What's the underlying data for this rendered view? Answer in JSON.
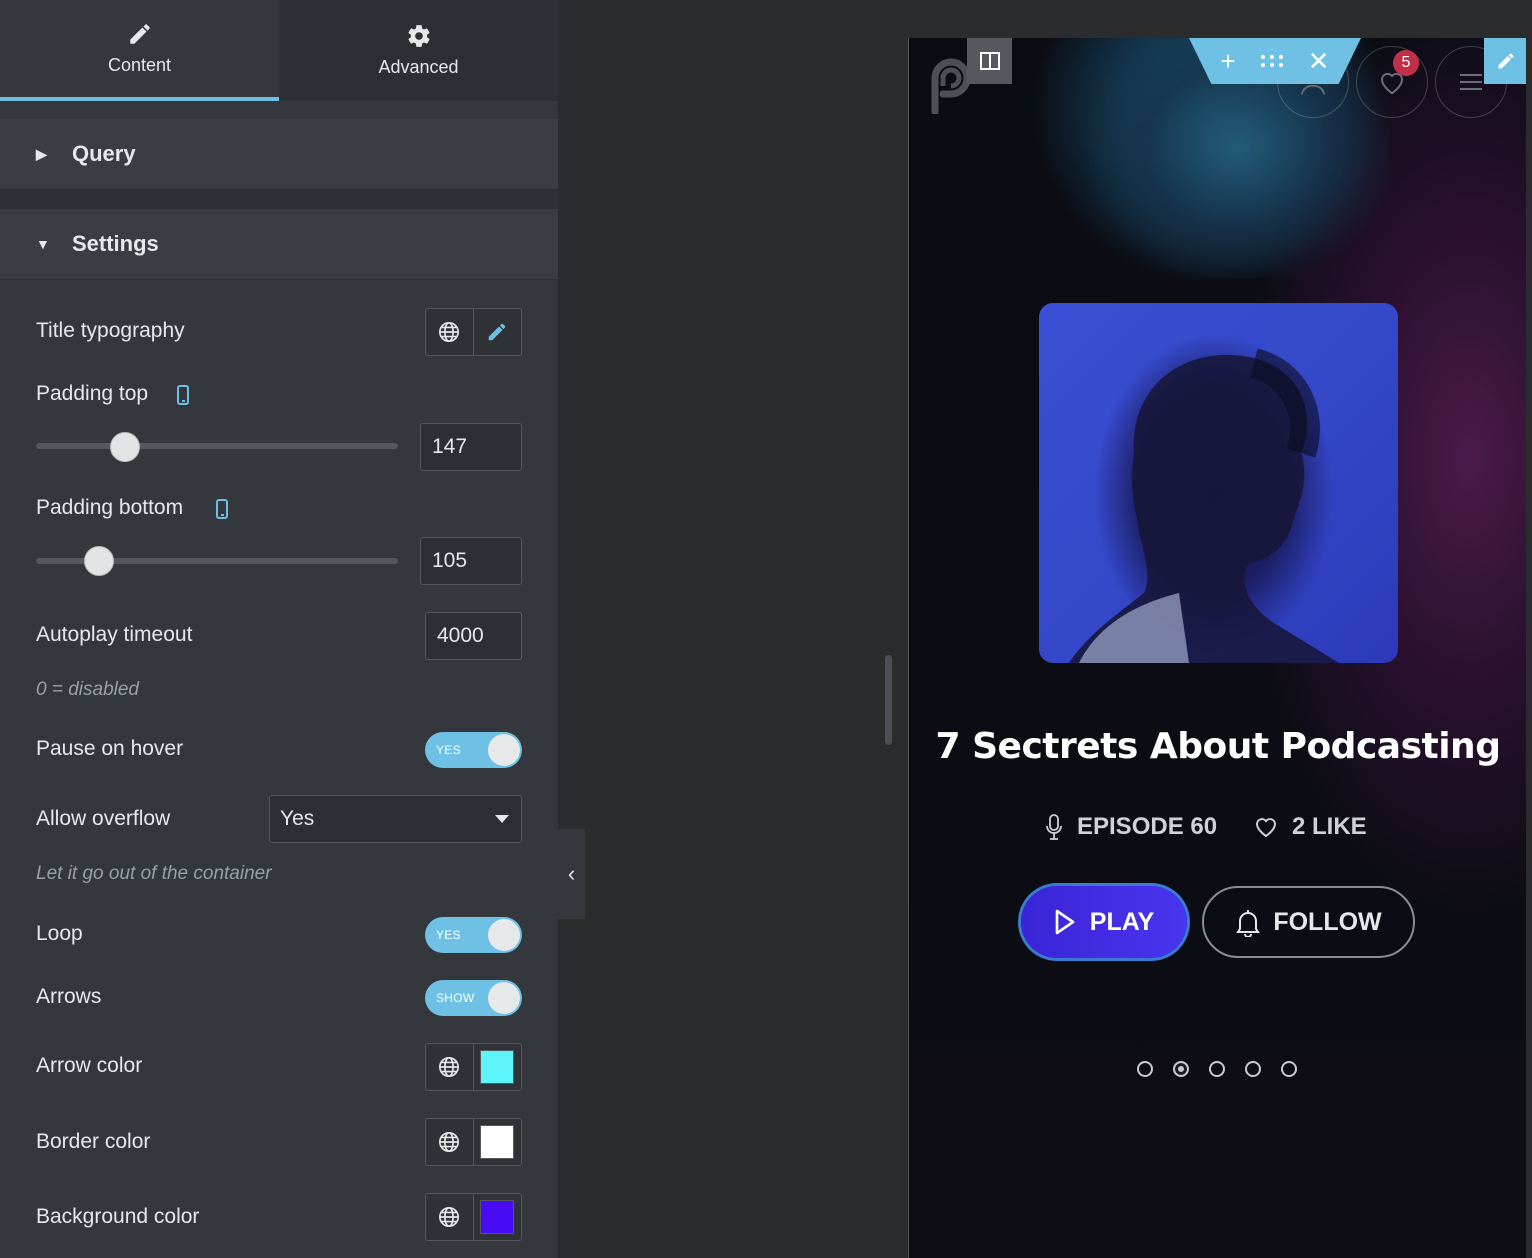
{
  "tabs": [
    {
      "label": "Content",
      "icon": "pencil-icon",
      "active": true
    },
    {
      "label": "Advanced",
      "icon": "gear-icon",
      "active": false
    }
  ],
  "sections": {
    "query": {
      "title": "Query",
      "expanded": false
    },
    "settings": {
      "title": "Settings",
      "expanded": true
    }
  },
  "settings": {
    "title_typography": {
      "label": "Title typography"
    },
    "padding_top": {
      "label": "Padding top",
      "value": "147",
      "slider_fraction": 0.25
    },
    "padding_bottom": {
      "label": "Padding bottom",
      "value": "105",
      "slider_fraction": 0.18
    },
    "autoplay_timeout": {
      "label": "Autoplay timeout",
      "value": "4000",
      "hint": "0 = disabled"
    },
    "pause_on_hover": {
      "label": "Pause on hover",
      "toggle": "YES",
      "on": true
    },
    "allow_overflow": {
      "label": "Allow overflow",
      "selected": "Yes",
      "hint": "Let it go out of the container"
    },
    "loop": {
      "label": "Loop",
      "toggle": "YES",
      "on": true
    },
    "arrows": {
      "label": "Arrows",
      "toggle": "SHOW",
      "on": true
    },
    "arrow_color": {
      "label": "Arrow color",
      "color": "#5ef4fb"
    },
    "border_color": {
      "label": "Border color",
      "color": "#ffffff"
    },
    "background_color": {
      "label": "Background color",
      "color": "#4a0cf5"
    }
  },
  "preview": {
    "badge_count": "5",
    "episode_title": "7 Sectrets About Podcasting",
    "episode_label": "EPISODE 60",
    "likes_label": "2 LIKE",
    "play_label": "PLAY",
    "follow_label": "FOLLOW",
    "slides_total": 5,
    "active_slide": 2
  },
  "colors": {
    "accent": "#6ec1e4",
    "panel_bg": "#34373c",
    "play_button": "#3f2ce6"
  }
}
